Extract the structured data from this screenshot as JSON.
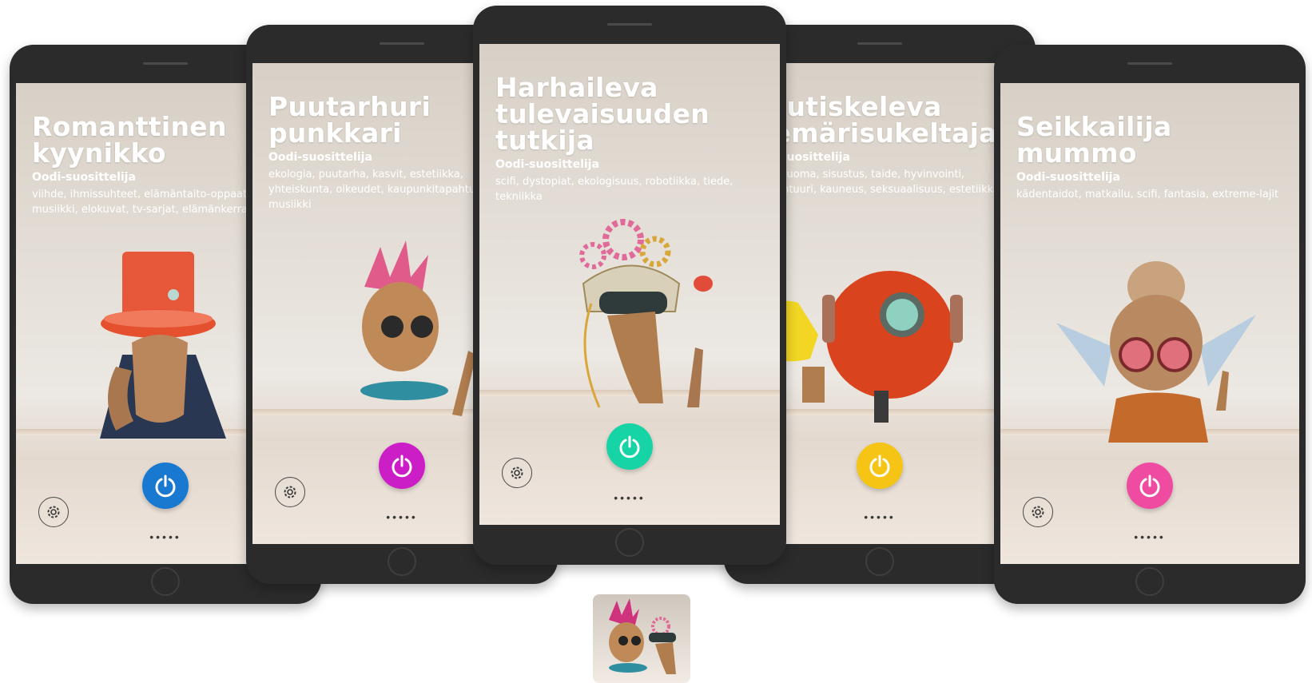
{
  "cards": [
    {
      "title_line1": "Romanttinen",
      "title_line2": "kyynikko",
      "title_line3": "",
      "subtitle": "Oodi-suosittelija",
      "tags_line1": "viihde, ihmissuhteet, elämäntaito-oppaat,",
      "tags_line2": "musiikki, elokuvat, tv-sarjat, elämänkerrat",
      "power_color": "#1978cf",
      "page_dots": "•••••",
      "power_icon": "power-icon",
      "settings_icon": "gear-icon"
    },
    {
      "title_line1": "Puutarhuri",
      "title_line2": "punkkari",
      "title_line3": "",
      "subtitle": "Oodi-suosittelija",
      "tags_line1": "ekologia, puutarha, kasvit, estetiikka,",
      "tags_line2": "yhteiskunta, oikeudet, kaupunkitapahtumat,",
      "tags_line3": "musiikki",
      "power_color": "#cc1ec7",
      "page_dots": "•••••",
      "power_icon": "power-icon",
      "settings_icon": "gear-icon"
    },
    {
      "title_line1": "Harhaileva",
      "title_line2": "tulevaisuuden",
      "title_line3": "tutkija",
      "subtitle": "Oodi-suosittelija",
      "tags_line1": "scifi, dystopiat, ekologisuus, robotiikka, tiede,",
      "tags_line2": "tekniikka",
      "power_color": "#16d4a6",
      "page_dots": "•••••",
      "power_icon": "power-icon",
      "settings_icon": "gear-icon"
    },
    {
      "title_line1": "Nautiskeleva",
      "title_line2": "viemärisukeltaja",
      "title_line3": "",
      "subtitle": "Oodi-suosittelija",
      "tags_line1": "ruoka&juoma, sisustus, taide, hyvinvointi,",
      "tags_line2": "arkkitehtuuri, kauneus, seksuaalisuus, estetiikka",
      "power_color": "#f5c414",
      "page_dots": "•••••",
      "power_icon": "power-icon",
      "settings_icon": "gear-icon"
    },
    {
      "title_line1": "Seikkailija",
      "title_line2": "mummo",
      "title_line3": "",
      "subtitle": "Oodi-suosittelija",
      "tags_line1": "kädentaidot, matkailu, scifi, fantasia, extreme-lajit",
      "tags_line2": "",
      "power_color": "#ef4ba1",
      "page_dots": "•••••",
      "power_icon": "power-icon",
      "settings_icon": "gear-icon"
    }
  ],
  "thumbnail_icon": "image-thumbnail"
}
